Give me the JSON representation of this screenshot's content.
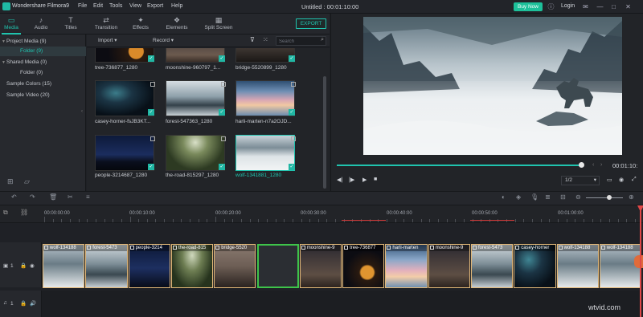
{
  "titlebar": {
    "app_name": "Wondershare Filmora9",
    "menus": [
      "File",
      "Edit",
      "Tools",
      "View",
      "Export",
      "Help"
    ],
    "document": "Untitled : 00:01:10:00",
    "buy_now": "Buy Now",
    "login": "Login"
  },
  "tabs": [
    {
      "label": "Media",
      "icon": "folder-icon",
      "active": true
    },
    {
      "label": "Audio",
      "icon": "music-note-icon"
    },
    {
      "label": "Titles",
      "icon": "text-icon"
    },
    {
      "label": "Transition",
      "icon": "transition-icon"
    },
    {
      "label": "Effects",
      "icon": "effects-icon"
    },
    {
      "label": "Elements",
      "icon": "elements-icon"
    },
    {
      "label": "Split Screen",
      "icon": "split-screen-icon"
    }
  ],
  "export_label": "EXPORT",
  "library": [
    {
      "label": "Project Media (9)",
      "expanded": true
    },
    {
      "label": "Folder (9)",
      "selected": true
    },
    {
      "label": "Shared Media (0)",
      "expanded": true
    },
    {
      "label": "Folder (0)"
    },
    {
      "label": "Sample Colors (15)"
    },
    {
      "label": "Sample Video (20)"
    }
  ],
  "media_toolbar": {
    "import": "Import",
    "record": "Record",
    "search_placeholder": "Search"
  },
  "media_items": [
    {
      "name": "tree-736877_1280"
    },
    {
      "name": "moonshine-960797_1..."
    },
    {
      "name": "bridge-5520899_1280"
    },
    {
      "name": "casey-horner-fsJB3KT..."
    },
    {
      "name": "forest-547363_1280"
    },
    {
      "name": "harli-marten-n7a2OJD..."
    },
    {
      "name": "people-3214687_1280"
    },
    {
      "name": "the-road-815297_1280"
    },
    {
      "name": "wolf-1341881_1280",
      "selected": true
    }
  ],
  "preview": {
    "timecode": "00:01:10:",
    "ratio": "1/2",
    "progress_fraction": 0.99
  },
  "ruler": [
    "00:00:00:00",
    "00:00:10:00",
    "00:00:20:00",
    "00:00:30:00",
    "00:00:40:00",
    "00:00:50:00",
    "00:01:00:00"
  ],
  "tracks": {
    "video_label": "1",
    "audio_label": "1"
  },
  "clips": [
    {
      "label": "wolf-134188"
    },
    {
      "label": "forest-5473"
    },
    {
      "label": "people-3214"
    },
    {
      "label": "the-road-815"
    },
    {
      "label": "bridge-5520"
    },
    {
      "label": ""
    },
    {
      "label": "moonshine-9"
    },
    {
      "label": "tree-736877"
    },
    {
      "label": "harli-marten"
    },
    {
      "label": "moonshine-9"
    },
    {
      "label": "forest-5473"
    },
    {
      "label": "casey-horner"
    },
    {
      "label": "wolf-134188"
    },
    {
      "label": "wolf-134188"
    }
  ],
  "watermark": "wtvid.com",
  "colors": {
    "accent": "#20c3ae",
    "buy": "#1dc09a",
    "playhead": "#e04747",
    "clip_border": "#e2b878"
  }
}
